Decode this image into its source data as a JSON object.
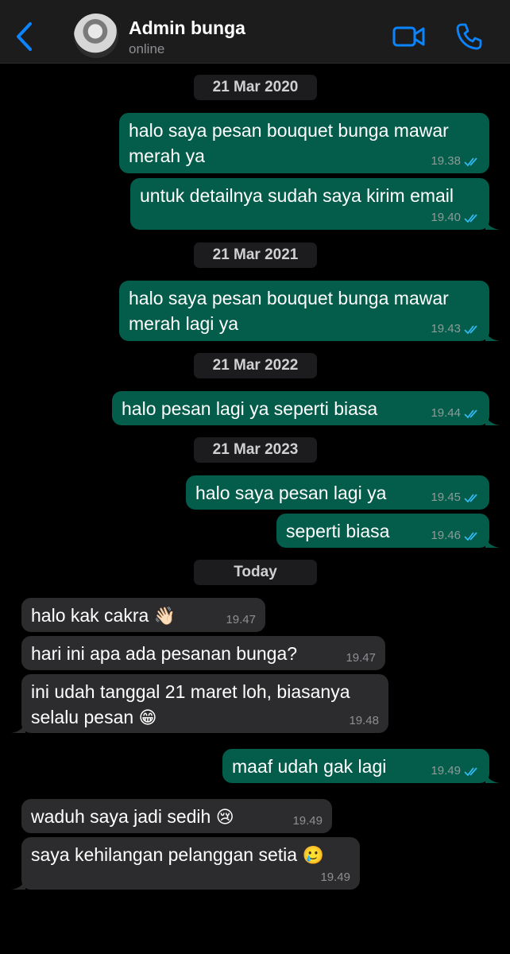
{
  "header": {
    "name": "Admin bunga",
    "status": "online",
    "accent": "#0a84ff"
  },
  "dates": [
    "21 Mar 2020",
    "21 Mar 2021",
    "21 Mar 2022",
    "21 Mar 2023",
    "Today"
  ],
  "messages": [
    {
      "dir": "out",
      "lines": [
        "halo saya pesan bouquet bunga mawar",
        "merah ya"
      ],
      "time": "19.38",
      "read": true
    },
    {
      "dir": "out",
      "lines": [
        "untuk detailnya sudah saya kirim email"
      ],
      "time": "19.40",
      "read": true
    },
    {
      "dir": "out",
      "lines": [
        "halo saya pesan bouquet bunga mawar",
        "merah lagi ya"
      ],
      "time": "19.43",
      "read": true
    },
    {
      "dir": "out",
      "lines": [
        "halo pesan lagi ya seperti biasa"
      ],
      "time": "19.44",
      "read": true
    },
    {
      "dir": "out",
      "lines": [
        "halo saya pesan lagi ya"
      ],
      "time": "19.45",
      "read": true
    },
    {
      "dir": "out",
      "lines": [
        "seperti biasa"
      ],
      "time": "19.46",
      "read": true
    },
    {
      "dir": "in",
      "lines": [
        "halo kak cakra"
      ],
      "emoji": "👋🏻",
      "time": "19.47"
    },
    {
      "dir": "in",
      "lines": [
        "hari ini apa ada pesanan bunga?"
      ],
      "time": "19.47"
    },
    {
      "dir": "in",
      "lines": [
        "ini udah tanggal 21 maret loh, biasanya",
        "selalu pesan"
      ],
      "emoji": "😁",
      "time": "19.48"
    },
    {
      "dir": "out",
      "lines": [
        "maaf udah gak lagi"
      ],
      "time": "19.49",
      "read": true
    },
    {
      "dir": "in",
      "lines": [
        "waduh saya jadi sedih"
      ],
      "emoji": "😢",
      "time": "19.49"
    },
    {
      "dir": "in",
      "lines": [
        "saya kehilangan pelanggan setia"
      ],
      "emoji": "🥲",
      "time": "19.49"
    }
  ],
  "colors": {
    "outgoing_bubble": "#045c4a",
    "incoming_bubble": "#2c2c2e",
    "read_ticks": "#34b7f1",
    "background": "#000000"
  }
}
